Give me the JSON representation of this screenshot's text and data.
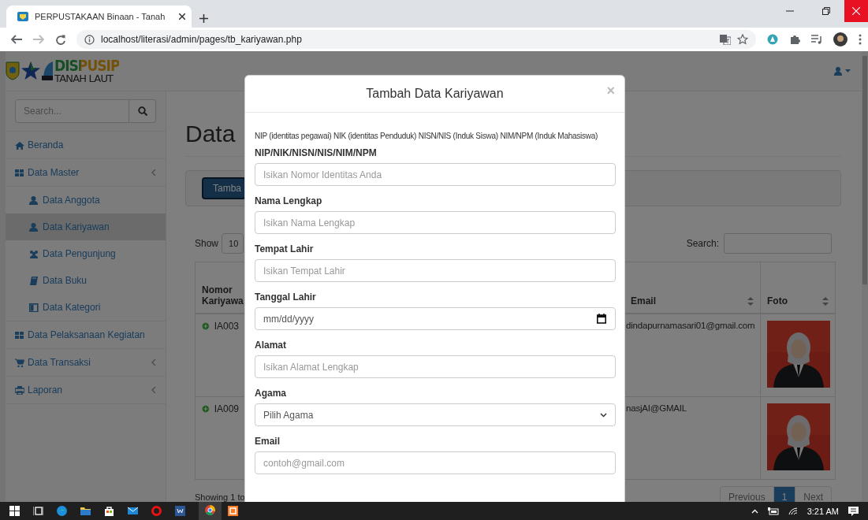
{
  "browser": {
    "tab_title": "PERPUSTAKAAN Binaan - Tanah",
    "url": "localhost/literasi/admin/pages/tb_kariyawan.php"
  },
  "header": {
    "logo_title": "DISPUSIP",
    "logo_subtitle": "TANAH LAUT"
  },
  "sidebar": {
    "search_placeholder": "Search...",
    "items": [
      {
        "label": "Beranda",
        "selected": false,
        "collapsible": false
      },
      {
        "label": "Data Master",
        "selected": false,
        "collapsible": true,
        "children": [
          {
            "label": "Data Anggota",
            "selected": false
          },
          {
            "label": "Data Kariyawan",
            "selected": true
          },
          {
            "label": "Data Pengunjung",
            "selected": false
          },
          {
            "label": "Data Buku",
            "selected": false
          },
          {
            "label": "Data Kategori",
            "selected": false
          }
        ]
      },
      {
        "label": "Data Pelaksanaan Kegiatan",
        "selected": false,
        "collapsible": false
      },
      {
        "label": "Data Transaksi",
        "selected": false,
        "collapsible": true
      },
      {
        "label": "Laporan",
        "selected": false,
        "collapsible": true
      }
    ]
  },
  "content": {
    "title": "Data",
    "add_button": "Tamba",
    "length_label": "Show",
    "length_value": "10",
    "search_label": "Search:",
    "table": {
      "columns": [
        {
          "label": "Nomor Kariyawa"
        },
        {
          "label": "Email",
          "sortable": true
        },
        {
          "label": "Foto",
          "sortable": true
        }
      ],
      "rows": [
        {
          "id": "IA003",
          "email": "dindapurnamasari01@gmail.com"
        },
        {
          "id": "IA009",
          "email": "nasjAI@GMAIL"
        }
      ]
    },
    "info": "Showing 1 to",
    "pagination": [
      {
        "label": "Previous",
        "selected": false
      },
      {
        "label": "1",
        "selected": true
      },
      {
        "label": "Next",
        "selected": false
      }
    ]
  },
  "modal": {
    "title": "Tambah Data Kariyawan",
    "close": "×",
    "hint": "NIP (identitas pegawai) NIK (identitas Penduduk) NISN/NIS (Induk Siswa) NIM/NPM (Induk Mahasiswa)",
    "fields": [
      {
        "label": "NIP/NIK/NISN/NIS/NIM/NPM",
        "kind": "text",
        "placeholder": "Isikan Nomor Identitas Anda"
      },
      {
        "label": "Nama Lengkap",
        "kind": "text",
        "placeholder": "Isikan Nama Lengkap"
      },
      {
        "label": "Tempat Lahir",
        "kind": "text",
        "placeholder": "Isikan Tempat Lahir"
      },
      {
        "label": "Tanggal Lahir",
        "kind": "date",
        "placeholder": "mm/dd/yyyy"
      },
      {
        "label": "Alamat",
        "kind": "text",
        "placeholder": "Isikan Alamat Lengkap"
      },
      {
        "label": "Agama",
        "kind": "select",
        "value": "Pilih Agama"
      },
      {
        "label": "Email",
        "kind": "text",
        "placeholder": "contoh@gmail.com"
      }
    ]
  },
  "taskbar": {
    "time": "3:21 AM"
  }
}
